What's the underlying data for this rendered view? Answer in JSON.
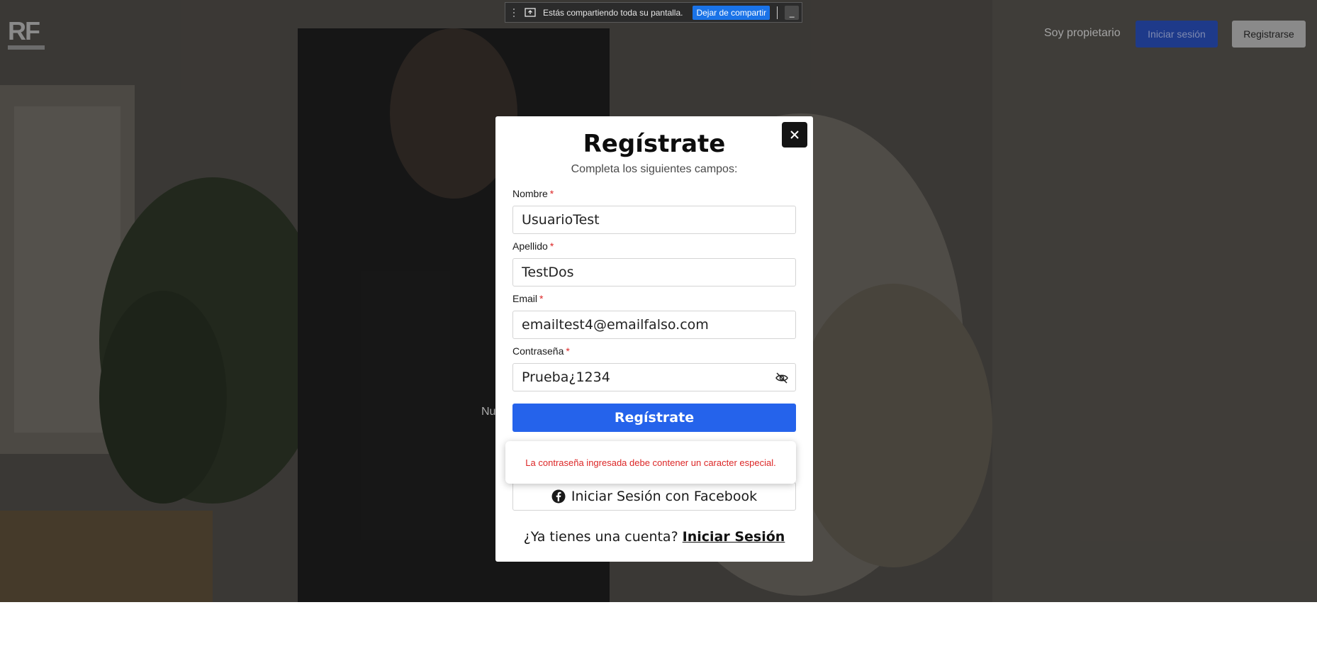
{
  "screen_share": {
    "message": "Estás compartiendo toda su pantalla.",
    "stop_label": "Dejar de compartir",
    "hide_label": "_"
  },
  "header": {
    "logo_text": "RF",
    "nav_owner": "Soy propietario",
    "login_label": "Iniciar sesión",
    "register_label": "Registrarse"
  },
  "hero": {
    "partial_text": "Nu"
  },
  "modal": {
    "title": "Regístrate",
    "subtitle": "Completa los siguientes campos:",
    "fields": [
      {
        "label": "Nombre",
        "required_mark": "*",
        "value": "UsuarioTest"
      },
      {
        "label": "Apellido",
        "required_mark": "*",
        "value": "TestDos"
      },
      {
        "label": "Email",
        "required_mark": "*",
        "value": "emailtest4@emailfalso.com"
      },
      {
        "label": "Contraseña",
        "required_mark": "*",
        "value": "Prueba¿1234"
      }
    ],
    "submit_label": "Regístrate",
    "facebook_label": "Iniciar Sesión con Facebook",
    "have_account": "¿Ya tienes una cuenta?",
    "login_link": "Iniciar Sesión"
  },
  "error_tooltip": {
    "message": "La contraseña ingresada debe contener un caracter especial."
  },
  "colors": {
    "primary": "#2563eb",
    "login_button": "#1e3a8a",
    "register_button": "#8a8a8a",
    "error": "#dc2626",
    "overlay": "#000000"
  }
}
